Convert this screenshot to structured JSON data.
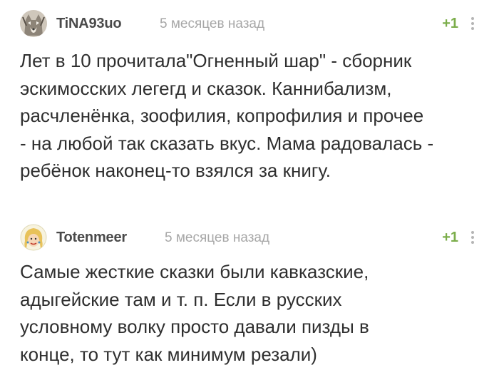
{
  "comments": [
    {
      "username": "TiNA93uo",
      "timestamp": "5 месяцев назад",
      "rating": "+1",
      "avatar_icon": "fox-avatar-icon",
      "text": "Лет в 10 прочитала\"Огненный шар\" - сборник\nэскимосских легегд и сказок. Каннибализм,\nрасчленёнка, зоофилия, копрофилия и прочее\n- на любой так сказать вкус. Мама радовалась -\nребёнок наконец-то взялся за книгу."
    },
    {
      "username": "Totenmeer",
      "timestamp": "5 месяцев назад",
      "rating": "+1",
      "avatar_icon": "blonde-woman-avatar-icon",
      "text": "Самые жесткие сказки были кавказские,\nадыгейские там и т. п. Если в русских\nусловному волку просто давали пизды в\nконце, то тут как минимум резали)"
    }
  ],
  "colors": {
    "username": "#4a4a4a",
    "timestamp": "#a7a7a7",
    "rating": "#7bad4a",
    "text": "#2f2f2f"
  }
}
